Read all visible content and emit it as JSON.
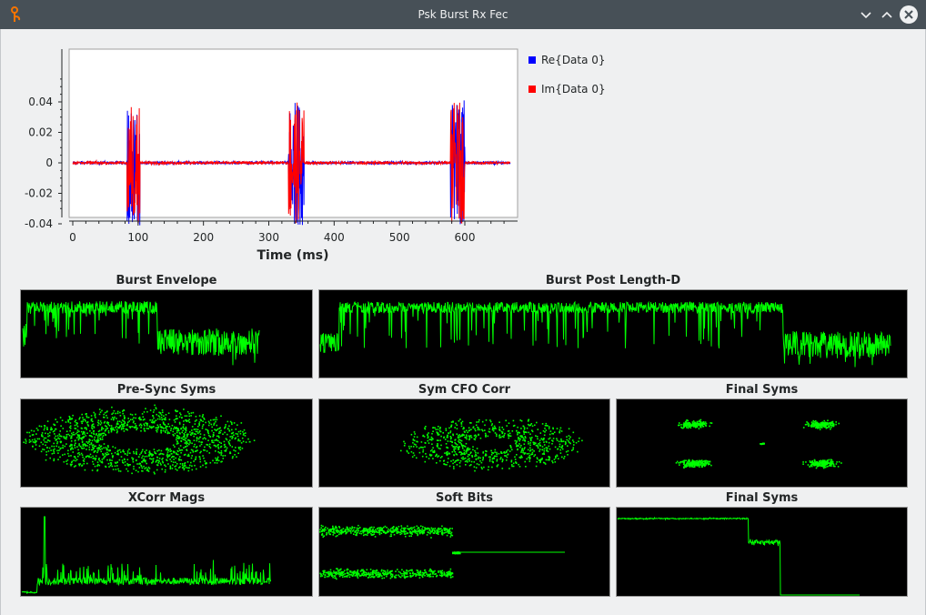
{
  "window": {
    "title": "Psk Burst Rx Fec",
    "app_icon": "gnuradio-logo-icon",
    "buttons": [
      "minimize-icon",
      "maximize-icon",
      "close-icon"
    ]
  },
  "colors": {
    "re": "#0000ff",
    "im": "#ff0000",
    "trace": "#00ff00",
    "panel_bg": "#000000"
  },
  "main_plot": {
    "xlabel": "Time (ms)",
    "xticks": [
      "0",
      "100",
      "200",
      "300",
      "400",
      "500",
      "600"
    ],
    "yticks": [
      "0.04",
      "0.02",
      "0",
      "-0.02",
      "-0.04"
    ],
    "legend": [
      {
        "label": "Re{Data 0}",
        "color": "#0000ff"
      },
      {
        "label": "Im{Data 0}",
        "color": "#ff0000"
      }
    ]
  },
  "chart_data": {
    "type": "line",
    "xlabel": "Time (ms)",
    "ylabel": "",
    "xlim": [
      0,
      670
    ],
    "ylim": [
      -0.05,
      0.055
    ],
    "grid": false,
    "legend_placement": "right",
    "series": [
      {
        "name": "Re{Data 0}",
        "color": "#0000ff",
        "baseline_amplitude": 0.002,
        "bursts_ms": [
          [
            83,
            103
          ],
          [
            330,
            354
          ],
          [
            578,
            600
          ]
        ],
        "burst_peak": 0.041
      },
      {
        "name": "Im{Data 0}",
        "color": "#ff0000",
        "baseline_amplitude": 0.002,
        "bursts_ms": [
          [
            83,
            103
          ],
          [
            330,
            354
          ],
          [
            578,
            600
          ]
        ],
        "burst_peak": 0.04
      }
    ]
  },
  "panels": [
    {
      "id": "burst-envelope",
      "title": "Burst Envelope"
    },
    {
      "id": "burst-post-length",
      "title": "Burst Post Length-D"
    },
    {
      "id": "pre-sync-syms",
      "title": "Pre-Sync Syms"
    },
    {
      "id": "sym-cfo-corr",
      "title": "Sym CFO Corr"
    },
    {
      "id": "final-syms-const",
      "title": "Final Syms"
    },
    {
      "id": "xcorr-mags",
      "title": "XCorr Mags"
    },
    {
      "id": "soft-bits",
      "title": "Soft Bits"
    },
    {
      "id": "final-syms-trace",
      "title": "Final Syms"
    }
  ]
}
